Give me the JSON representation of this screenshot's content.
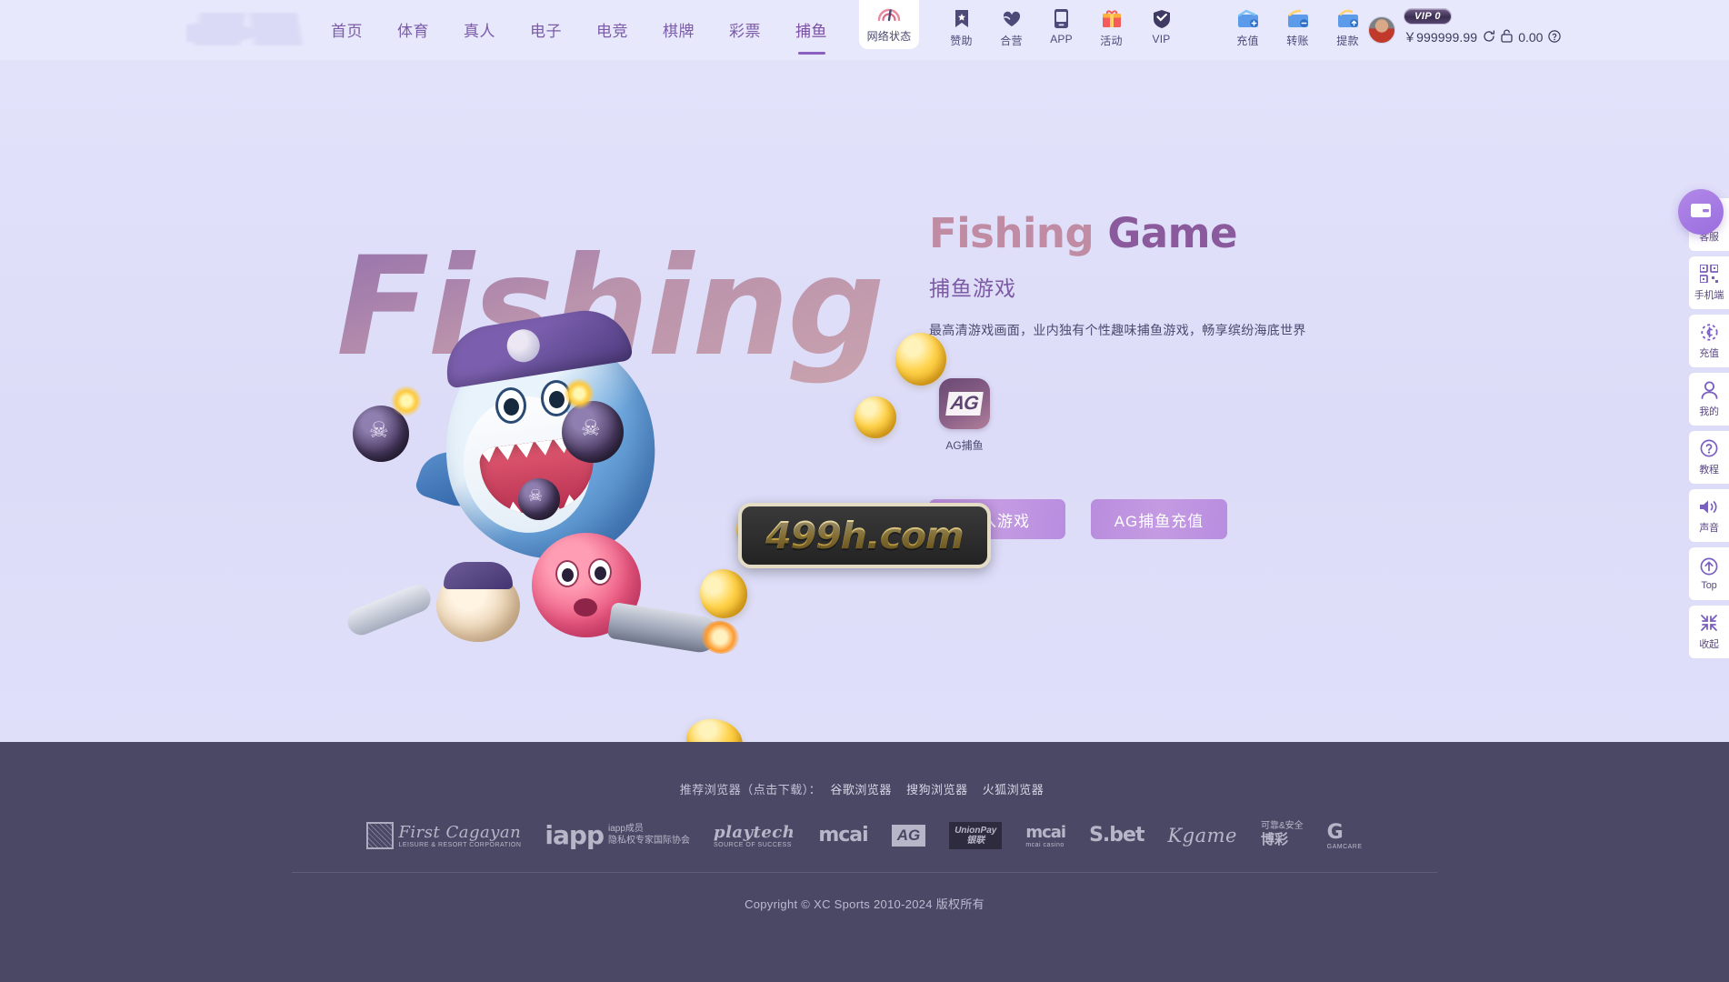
{
  "header": {
    "logo_name": "site-logo",
    "nav": [
      {
        "label": "首页",
        "active": false
      },
      {
        "label": "体育",
        "active": false
      },
      {
        "label": "真人",
        "active": false
      },
      {
        "label": "电子",
        "active": false
      },
      {
        "label": "电竞",
        "active": false
      },
      {
        "label": "棋牌",
        "active": false
      },
      {
        "label": "彩票",
        "active": false
      },
      {
        "label": "捕鱼",
        "active": true
      }
    ],
    "network_status": {
      "label": "网络状态",
      "icon": "signal-gauge-icon"
    },
    "icons": [
      {
        "label": "赞助",
        "icon": "bookmark-star-icon"
      },
      {
        "label": "合营",
        "icon": "handshake-heart-icon"
      },
      {
        "label": "APP",
        "icon": "mobile-phone-icon"
      },
      {
        "label": "活动",
        "icon": "gift-icon"
      },
      {
        "label": "VIP",
        "icon": "vip-shield-icon"
      }
    ],
    "pay_icons": [
      {
        "label": "充值",
        "icon": "wallet-plus-icon"
      },
      {
        "label": "转账",
        "icon": "wallet-transfer-icon"
      },
      {
        "label": "提款",
        "icon": "wallet-withdraw-icon"
      }
    ],
    "account": {
      "avatar": "user-avatar",
      "vip_badge": "VIP 0",
      "currency_symbol": "￥",
      "balance": "999999.99",
      "refresh_icon": "refresh-icon",
      "lock_icon": "unlock-icon",
      "locked_amount": "0.00",
      "help_icon": "question-circle-icon"
    }
  },
  "hero": {
    "backdrop_word": "Fishing",
    "title_part1": "Fishing",
    "title_part2": "Game",
    "subtitle": "捕鱼游戏",
    "description": "最高清游戏画面，业内独有个性趣味捕鱼游戏，畅享缤纷海底世界",
    "game_card": {
      "logo_text": "AG",
      "caption": "AG捕鱼"
    },
    "buttons": [
      {
        "label": "进入游戏",
        "name": "enter-game-button"
      },
      {
        "label": "AG捕鱼充值",
        "name": "ag-recharge-button"
      }
    ],
    "watermark": "499h.com"
  },
  "rail": {
    "float_icon": "wallet-float-icon",
    "items": [
      {
        "label": "客服",
        "icon": "headset-icon"
      },
      {
        "label": "手机端",
        "icon": "qrcode-icon"
      },
      {
        "label": "充值",
        "icon": "recharge-coin-icon"
      },
      {
        "label": "我的",
        "icon": "user-icon"
      },
      {
        "label": "教程",
        "icon": "question-circle-icon"
      },
      {
        "label": "声音",
        "icon": "speaker-icon"
      },
      {
        "label": "Top",
        "icon": "arrow-up-circle-icon"
      },
      {
        "label": "收起",
        "icon": "collapse-icon"
      }
    ]
  },
  "footer": {
    "browsers_label": "推荐浏览器（点击下载）：",
    "browsers": [
      "谷歌浏览器",
      "搜狗浏览器",
      "火狐浏览器"
    ],
    "logos": [
      {
        "name": "first-cagayan",
        "text": "First Cagayan",
        "sub": "LEISURE & RESORT CORPORATION"
      },
      {
        "name": "iapp",
        "text": "iapp",
        "line1": "iapp成员",
        "line2": "隐私权专家国际协会"
      },
      {
        "name": "playtech",
        "text": "playtech",
        "sub": "SOURCE OF SUCCESS"
      },
      {
        "name": "mcai",
        "text": "mcai"
      },
      {
        "name": "ag",
        "text": "AG"
      },
      {
        "name": "unionpay",
        "text": "UnionPay",
        "sub": "银联"
      },
      {
        "name": "mcai-casino",
        "text": "mcai",
        "sub": "mcai casino"
      },
      {
        "name": "sbet",
        "text": "S.bet"
      },
      {
        "name": "kgame",
        "text": "Kgame"
      },
      {
        "name": "safe-gambling",
        "line1": "可靠&安全",
        "line2": "博彩"
      },
      {
        "name": "gamcare",
        "text": "G",
        "sub": "GAMCARE"
      }
    ],
    "copyright": "Copyright © XC Sports 2010-2024 版权所有"
  }
}
